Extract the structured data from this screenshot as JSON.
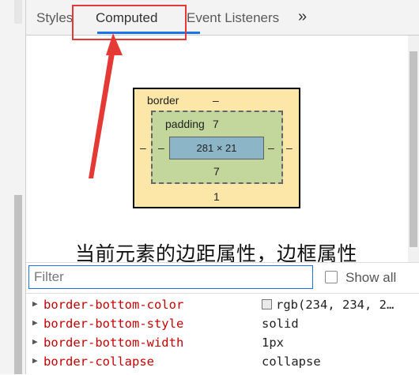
{
  "tabs": {
    "styles": "Styles",
    "computed": "Computed",
    "event_listeners": "Event Listeners",
    "more": "»"
  },
  "box_model": {
    "margin_label": "border",
    "margin_top": "–",
    "margin_left": "–",
    "margin_right": "–",
    "border_bottom": "1",
    "padding_label": "padding",
    "padding_top": "7",
    "padding_left": "–",
    "padding_right": "–",
    "padding_bottom": "7",
    "content_size": "281 × 21"
  },
  "annotation": "当前元素的边距属性，边框属性",
  "filter": {
    "placeholder": "Filter",
    "show_all_label": "Show all"
  },
  "properties": [
    {
      "name": "border-bottom-color",
      "value": "rgb(234, 234, 2…"
    },
    {
      "name": "border-bottom-style",
      "value": "solid"
    },
    {
      "name": "border-bottom-width",
      "value": "1px"
    },
    {
      "name": "border-collapse",
      "value": "collapse"
    }
  ],
  "colors": {
    "accent": "#1a73e8",
    "highlight": "#e53935",
    "margin_fill": "#fde7a8",
    "border_fill": "#c3d69b",
    "content_fill": "#8cb6c8",
    "property_name": "#c80000"
  }
}
